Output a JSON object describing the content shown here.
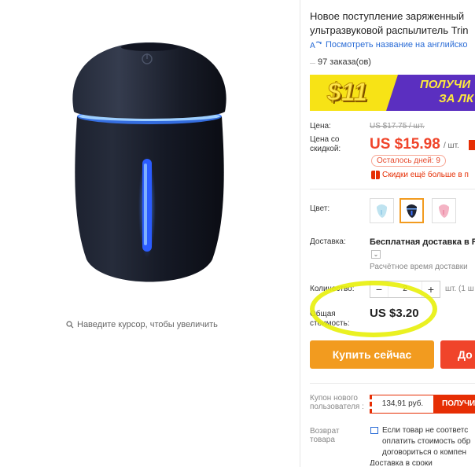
{
  "product": {
    "title_line1": "Новое поступление заряженный",
    "title_line2": "ультразвуковой распылитель Trin",
    "translate_link": "Посмотреть название на английско",
    "orders": "97 заказа(ов)"
  },
  "promo": {
    "amount": "$11",
    "text_line1": "ПОЛУЧИ",
    "text_line2": "ЗА ЛК"
  },
  "price": {
    "label": "Цена:",
    "old": "US $17.75 / шт.",
    "sale_label": "Цена со скидкой:",
    "sale": "US $15.98",
    "per_unit": "/ шт.",
    "days_left": "Осталось дней: 9",
    "more_discounts": "Скидки ещё больше в п"
  },
  "options": {
    "color_label": "Цвет:",
    "colors": [
      "light-blue",
      "black",
      "pink"
    ],
    "selected_color": "black",
    "swatch_colors": {
      "light-blue": "#bfe3f0",
      "black": "#1f2433",
      "pink": "#f4b3c4"
    }
  },
  "shipping": {
    "label": "Доставка:",
    "value": "Бесплатная доставка в Ru",
    "dropdown": "⌄",
    "time": "Расчётное время доставки"
  },
  "quantity": {
    "label": "Количество:",
    "minus": "−",
    "value": "2",
    "plus": "+",
    "unit": "шт. (1 ш"
  },
  "total": {
    "label": "Общая стоимость:",
    "value": "US $3.20"
  },
  "actions": {
    "buy_now": "Купить сейчас",
    "add_to_cart": "До"
  },
  "coupon": {
    "label": "Купон нового пользователя :",
    "amount": "134,91 руб.",
    "get": "ПОЛУЧИ"
  },
  "returns": {
    "label": "Возврат товара",
    "line1": "Если товар не соответс",
    "line2": "оплатить стоимость обр",
    "line3": "договориться о компен",
    "line4": "Доставка в сроки"
  },
  "gallery": {
    "zoom_hint": "Наведите курсор, чтобы увеличить"
  },
  "colors": {
    "accent_orange": "#f29b1f",
    "sale_red": "#f0442a",
    "link_blue": "#2a6cd6",
    "highlight_yellow": "#e8f00a"
  }
}
